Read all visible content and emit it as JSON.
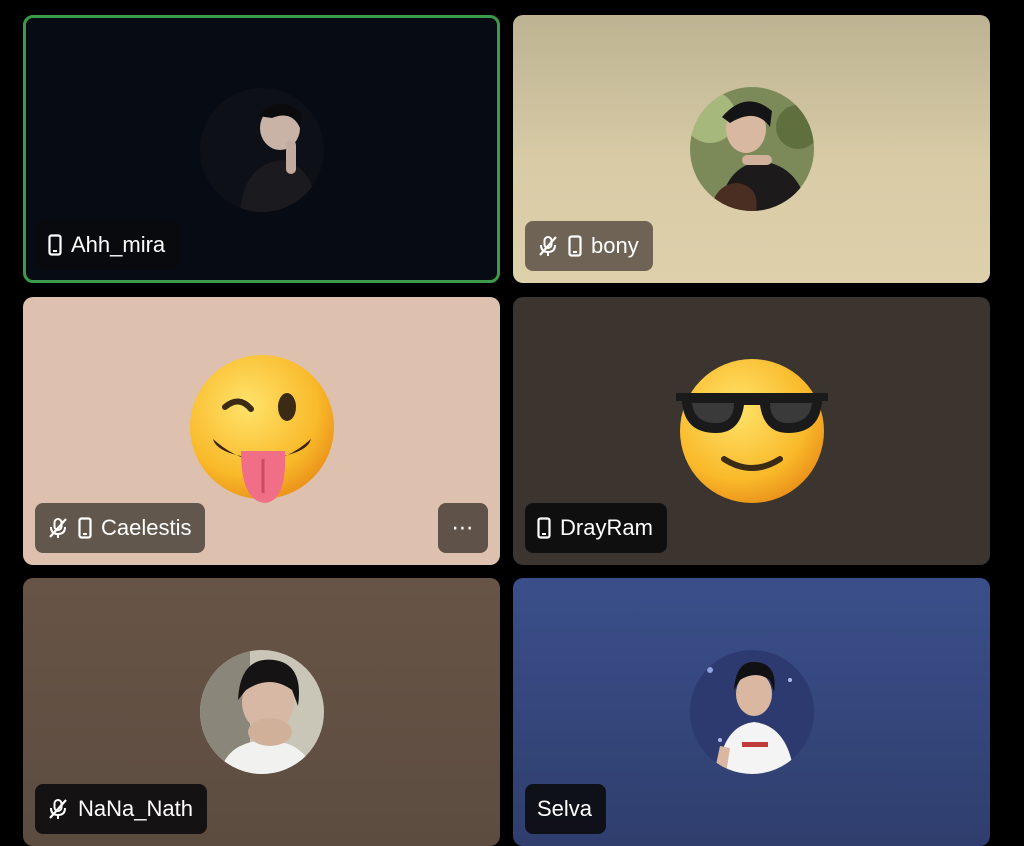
{
  "participants": [
    {
      "name": "Ahh_mira",
      "muted": false,
      "device": "phone-icon",
      "speaking": true
    },
    {
      "name": "bony",
      "muted": true,
      "device": "phone-icon"
    },
    {
      "name": "Caelestis",
      "muted": true,
      "device": "phone-icon",
      "avatar": "winking-tongue-emoji"
    },
    {
      "name": "DrayRam",
      "muted": false,
      "device": "phone-icon",
      "avatar": "sunglasses-emoji"
    },
    {
      "name": "NaNa_Nath",
      "muted": true
    },
    {
      "name": "Selva",
      "muted": false
    }
  ],
  "more_button": {
    "label": "⋯"
  },
  "colors": {
    "speaking_border": "#3c9a4b"
  }
}
